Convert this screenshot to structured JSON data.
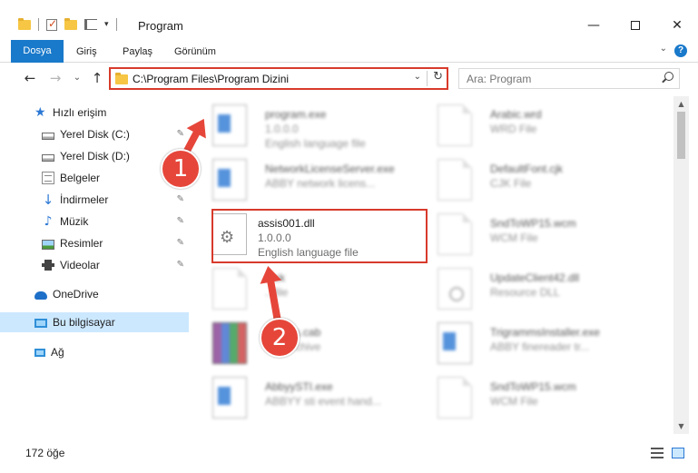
{
  "window": {
    "title": "Program",
    "minimize": "—",
    "close": "✕"
  },
  "ribbon": {
    "tabs": [
      "Dosya",
      "Giriş",
      "Paylaş",
      "Görünüm"
    ],
    "help": "?",
    "expand": "⌄"
  },
  "nav": {
    "back": "←",
    "forward": "→",
    "recent": "⌄",
    "up": "↑"
  },
  "address": {
    "path": "C:\\Program Files\\Program Dizini",
    "dropdown": "⌄",
    "refresh": "↻"
  },
  "search": {
    "placeholder": "Ara: Program"
  },
  "sidebar": {
    "items": [
      {
        "label": "Hızlı erişim",
        "icon": "star-icon"
      },
      {
        "label": "Yerel Disk (C:)",
        "icon": "disk-icon",
        "pinned": true
      },
      {
        "label": "Yerel Disk (D:)",
        "icon": "disk-icon"
      },
      {
        "label": "Belgeler",
        "icon": "documents-icon"
      },
      {
        "label": "İndirmeler",
        "icon": "download-icon",
        "pinned": true
      },
      {
        "label": "Müzik",
        "icon": "music-icon",
        "pinned": true
      },
      {
        "label": "Resimler",
        "icon": "pictures-icon",
        "pinned": true
      },
      {
        "label": "Videolar",
        "icon": "videos-icon",
        "pinned": true
      },
      {
        "label": "OneDrive",
        "icon": "cloud-icon"
      },
      {
        "label": "Bu bilgisayar",
        "icon": "computer-icon",
        "selected": true
      },
      {
        "label": "Ağ",
        "icon": "network-icon"
      }
    ],
    "pin_glyph": "📌"
  },
  "files": {
    "left": [
      {
        "name": "program.exe",
        "version": "1.0.0.0",
        "desc": "English language file",
        "icon": "setup-icon"
      },
      {
        "name": "NetworkLicenseServer.exe",
        "version": "ABBY network licens...",
        "desc": "",
        "icon": "app-window-icon"
      },
      {
        "name": "assis001.dll",
        "version": "1.0.0.0",
        "desc": "English language file",
        "icon": "dll-gear-icon"
      },
      {
        "name": "...ck",
        "version": "...file",
        "desc": "",
        "icon": "document-icon"
      },
      {
        "name": "...cates.cab",
        "version": "...R Archive",
        "desc": "",
        "icon": "winrar-icon"
      },
      {
        "name": "AbbyySTI.exe",
        "version": "ABBYY sti event hand...",
        "desc": "",
        "icon": "app-window-icon"
      }
    ],
    "right": [
      {
        "name": "Arabic.wrd",
        "version": "WRD File",
        "icon": "document-icon"
      },
      {
        "name": "DefaultFont.cjk",
        "version": "CJK File",
        "icon": "document-icon"
      },
      {
        "name": "SndToWP15.wcm",
        "version": "WCM File",
        "icon": "document-icon"
      },
      {
        "name": "UpdateClient42.dll",
        "version": "Resource DLL",
        "icon": "resource-dll-icon"
      },
      {
        "name": "TrigrammsInstaller.exe",
        "version": "ABBY finereader tr...",
        "icon": "app-window-icon"
      },
      {
        "name": "SndToWP15.wcm",
        "version": "WCM File",
        "icon": "document-icon"
      }
    ]
  },
  "status": {
    "count": "172 öğe"
  },
  "annotations": {
    "one": "1",
    "two": "2",
    "color": "#e6463a"
  },
  "colors": {
    "accent": "#1979ca",
    "highlight": "#d83a2b",
    "selected": "#cce8ff"
  }
}
